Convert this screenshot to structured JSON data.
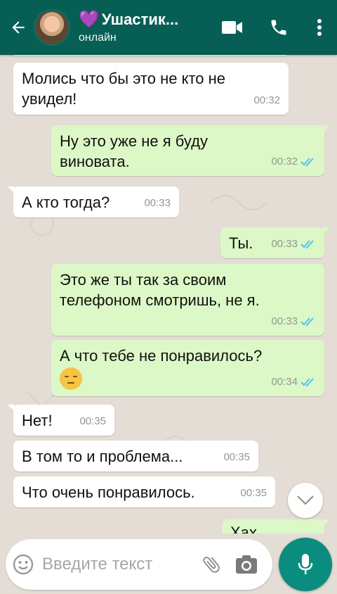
{
  "header": {
    "contact_name": "Ушастик...",
    "status": "онлайн",
    "heart_icon": "purple-heart",
    "colors": {
      "bar": "#075e54",
      "text": "#ffffff"
    }
  },
  "messages": [
    {
      "side": "in",
      "text": "Молись что бы это не кто не увидел!",
      "time": "00:32"
    },
    {
      "side": "out",
      "text": "Ну это уже не я буду виновата.",
      "time": "00:32",
      "read": true
    },
    {
      "side": "in",
      "text": "А кто тогда?",
      "time": "00:33"
    },
    {
      "side": "out",
      "text": "Ты.",
      "time": "00:33",
      "read": true
    },
    {
      "side": "out",
      "text": "Это же ты так за своим телефоном смотришь, не я.",
      "time": "00:33",
      "read": true
    },
    {
      "side": "out",
      "text": "А что тебе не понравилось?",
      "emoji": "pensive-face",
      "time": "00:34",
      "read": true
    },
    {
      "side": "in",
      "text": "Нет!",
      "time": "00:35"
    },
    {
      "side": "in",
      "text": "В том то и проблема...",
      "time": "00:35"
    },
    {
      "side": "in",
      "text": "Что очень понравилось.",
      "time": "00:35"
    },
    {
      "side": "out",
      "text": "Хах",
      "time": "",
      "partial": true
    }
  ],
  "input": {
    "placeholder": "Введите текст"
  },
  "colors": {
    "outgoing": "#dcf8c6",
    "incoming": "#ffffff",
    "tick": "#4fc3f7",
    "fab": "#0a8d7e"
  }
}
